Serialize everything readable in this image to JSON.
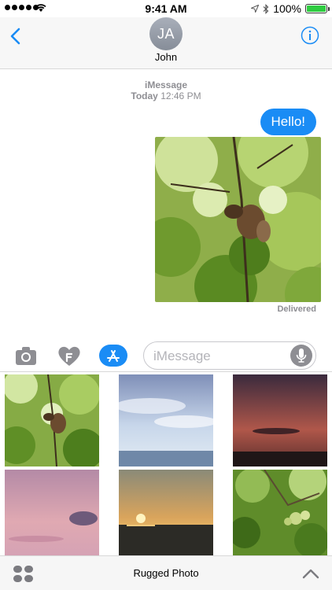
{
  "status_bar": {
    "time": "9:41 AM",
    "battery_text": "100%",
    "battery_level": 1.0,
    "icons": [
      "signal-dots",
      "wifi-icon",
      "location-icon",
      "bluetooth-icon",
      "battery-icon"
    ]
  },
  "header": {
    "avatar_initials": "JA",
    "contact_name": "John",
    "icons": [
      "chevron-left-icon",
      "info-icon"
    ],
    "accent_color": "#1a8cf5"
  },
  "conversation": {
    "service": "iMessage",
    "date_label": "Today",
    "time_label": "12:46 PM",
    "messages": [
      {
        "type": "text",
        "text": "Hello!",
        "bubble_color": "#1a8cf5"
      },
      {
        "type": "photo",
        "subject": "squirrel in tree branches"
      }
    ],
    "delivery_status": "Delivered"
  },
  "input_bar": {
    "placeholder": "iMessage",
    "value": "",
    "icons": [
      "camera-icon",
      "heart-digital-touch-icon",
      "app-store-icon",
      "microphone-icon"
    ]
  },
  "photo_grid": {
    "photos": [
      {
        "subject": "squirrel in green leaves"
      },
      {
        "subject": "blue sky over sea"
      },
      {
        "subject": "dark red sunset"
      },
      {
        "subject": "pink clouds"
      },
      {
        "subject": "sunset over water"
      },
      {
        "subject": "apples on a tree"
      }
    ]
  },
  "bottom_bar": {
    "app_name": "Rugged Photo",
    "icons": [
      "apps-grid-icon",
      "chevron-up-icon"
    ]
  }
}
